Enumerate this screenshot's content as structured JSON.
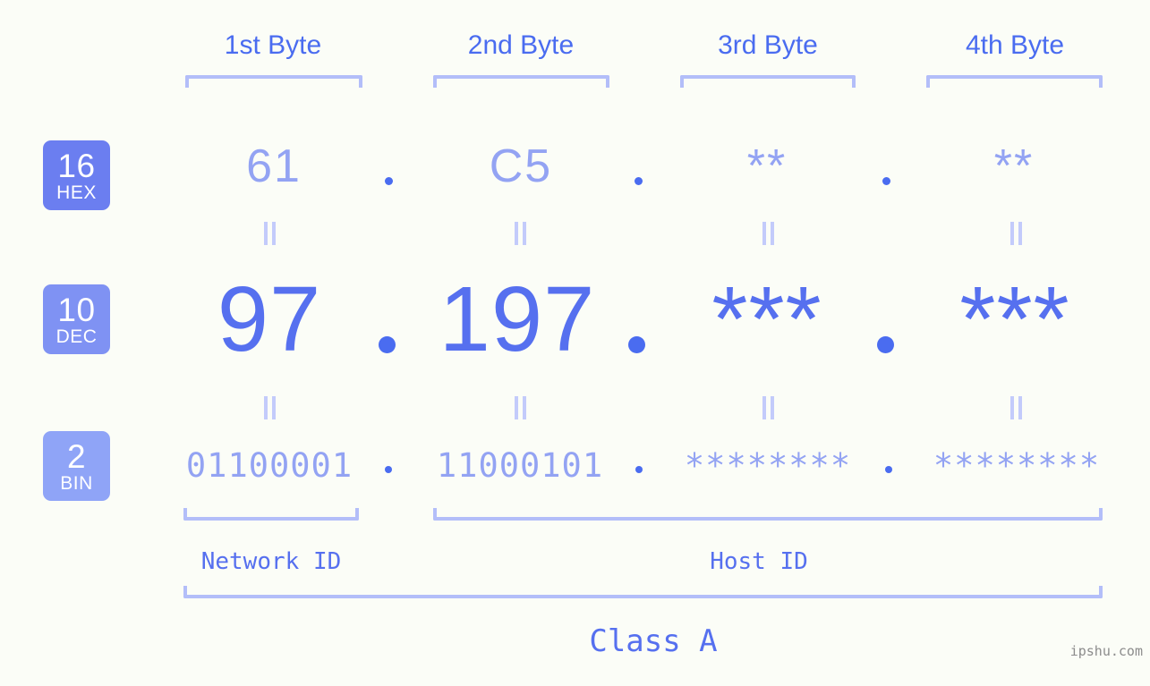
{
  "background_color": "#fbfdf7",
  "accent_colors": {
    "header_text": "#4a6cf0",
    "bracket": "#b3bef9",
    "hex_value": "#93a3f3",
    "dec_value": "#5670ef",
    "bin_value": "#93a3f3",
    "badge_hex": "#6b7ef0",
    "badge_dec": "#7f92f3",
    "badge_bin": "#8fa4f7",
    "equals_mark": "#c3cbfb",
    "dot": "#4a6cf0",
    "watermark": "#8c8c8c"
  },
  "byte_headers": [
    {
      "label": "1st Byte"
    },
    {
      "label": "2nd Byte"
    },
    {
      "label": "3rd Byte"
    },
    {
      "label": "4th Byte"
    }
  ],
  "bases": [
    {
      "num": "16",
      "label": "HEX"
    },
    {
      "num": "10",
      "label": "DEC"
    },
    {
      "num": "2",
      "label": "BIN"
    }
  ],
  "rows": {
    "hex": {
      "base": "16",
      "base_label": "HEX",
      "values": [
        "61",
        "C5",
        "**",
        "**"
      ]
    },
    "dec": {
      "base": "10",
      "base_label": "DEC",
      "values": [
        "97",
        "197",
        "***",
        "***"
      ]
    },
    "bin": {
      "base": "2",
      "base_label": "BIN",
      "values": [
        "01100001",
        "11000101",
        "********",
        "********"
      ]
    }
  },
  "separators": {
    "hex": ".",
    "dec": ".",
    "bin": "."
  },
  "id_labels": {
    "network": "Network ID",
    "host": "Host ID"
  },
  "class_label": "Class A",
  "watermark": "ipshu.com"
}
